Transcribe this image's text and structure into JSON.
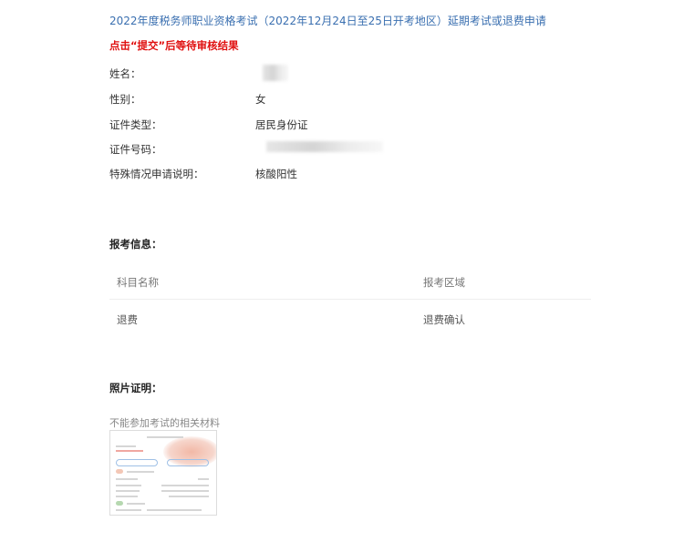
{
  "header": {
    "title": "2022年度税务师职业资格考试（2022年12月24日至25日开考地区）延期考试或退费申请",
    "notice": "点击“提交”后等待审核结果"
  },
  "applicant": {
    "name_label": "姓名：",
    "gender_label": "性别：",
    "gender_value": "女",
    "id_type_label": "证件类型：",
    "id_type_value": "居民身份证",
    "id_number_label": "证件号码：",
    "special_label": "特殊情况申请说明：",
    "special_value": "核酸阳性"
  },
  "registration": {
    "section_title": "报考信息：",
    "columns": [
      "科目名称",
      "报考区域"
    ],
    "rows": [
      [
        "退费",
        "退费确认"
      ]
    ]
  },
  "photo": {
    "section_title": "照片证明：",
    "caption": "不能参加考试的相关材料"
  },
  "colors": {
    "title": "#3a6fb0",
    "notice": "#e01010"
  }
}
